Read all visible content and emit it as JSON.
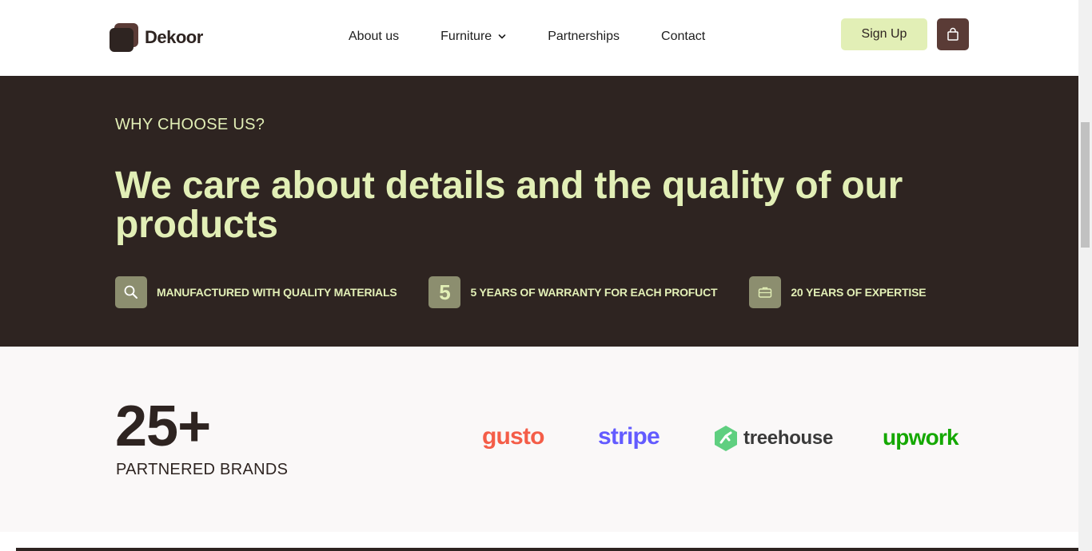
{
  "header": {
    "logo_text": "Dekoor",
    "nav": [
      "About us",
      "Furniture",
      "Partnerships",
      "Contact"
    ],
    "signup_label": "Sign Up"
  },
  "why": {
    "eyebrow": "WHY CHOOSE US?",
    "headline": "We care about details and the quality of our products",
    "features": [
      {
        "icon": "search-icon",
        "label": "MANUFACTURED WITH QUALITY MATERIALS"
      },
      {
        "icon": "5",
        "label": "5 YEARS OF WARRANTY FOR EACH PROFUCT"
      },
      {
        "icon": "briefcase-icon",
        "label": "20 YEARS OF EXPERTISE"
      }
    ]
  },
  "partners": {
    "count": "25+",
    "label": "PARTNERED BRANDS",
    "brands": [
      "gusto",
      "stripe",
      "treehouse",
      "upwork"
    ]
  },
  "colors": {
    "dark": "#2e2421",
    "accent": "#e2efb6",
    "brown": "#5a3b36",
    "icon_bg": "#8c8e6f"
  }
}
